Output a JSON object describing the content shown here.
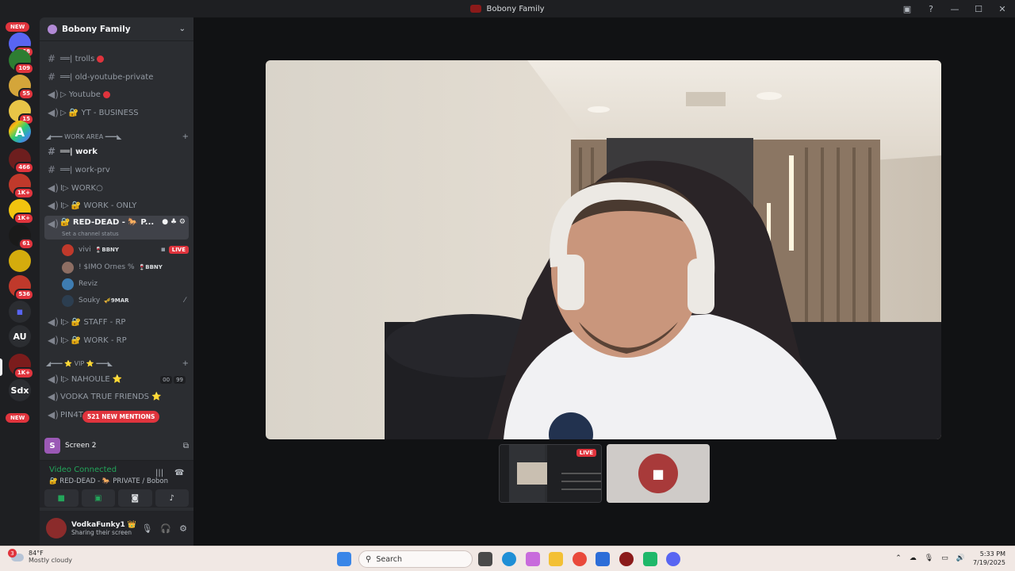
{
  "window": {
    "title": "Bobony Family"
  },
  "rail": {
    "new_top": "NEW",
    "new_bottom": "NEW",
    "badges": [
      "868",
      "109",
      "55",
      "15",
      "466",
      "1K+",
      "1K+",
      "61",
      "536",
      "1K+"
    ],
    "text_servers": [
      "AU",
      "Sdx"
    ],
    "letter_server": "A"
  },
  "guild": {
    "name": "Bobony Family"
  },
  "channels": {
    "trolls": "══| trolls",
    "old_youtube": "══| old-youtube-private",
    "youtube": "▷ Youtube",
    "yt_business": "▷ 🔐 YT - BUSINESS",
    "cat_work": "◢━━━ WORK AREA ━━━◣",
    "work": "══| work",
    "work_prv": "══| work-prv",
    "work_o": "I▷ WORK○",
    "work_only": "I▷ 🔐 WORK - ONLY",
    "red_dead": "🔐 RED-DEAD - 🐎 P...",
    "red_dead_status": "Set a channel status",
    "staff_rp": "I▷ 🔐 STAFF - RP",
    "work_rp": "I▷ 🔐 WORK - RP",
    "cat_vip": "◢━━━ ⭐ VIP ⭐ ━━━◣",
    "nahoule": "I▷ NAHOULE ⭐",
    "nahoule_c1": "00",
    "nahoule_c2": "99",
    "vodka": "VODKA TRUE FRIENDS ⭐",
    "pin": "PIN4T",
    "mentions": "521 NEW MENTIONS"
  },
  "voice_users": [
    {
      "name": "vivi",
      "tag": "🍷BBNY",
      "live": "LIVE"
    },
    {
      "name": "! $IMO Ornes %",
      "tag": "🍷BBNY"
    },
    {
      "name": "Reviz",
      "tag": ""
    },
    {
      "name": "Souky",
      "tag": "🎺9MAR"
    }
  ],
  "screen_share": {
    "label": "Screen 2",
    "letter": "S"
  },
  "voice_connection": {
    "status": "Video Connected",
    "channel": "🔐 RED-DEAD - 🐎 PRIVATE / Bobony F..."
  },
  "user": {
    "name": "VodkaFunky1 👑",
    "status": "Sharing their screen"
  },
  "thumbs": {
    "live": "LIVE"
  },
  "taskbar": {
    "temperature": "84°F",
    "weather": "Mostly cloudy",
    "weather_badge": "3",
    "search_placeholder": "Search",
    "time": "5:33 PM",
    "date": "7/19/2025"
  },
  "colors": {
    "accent_red": "#e0343d",
    "connected_green": "#23a55a",
    "sidebar": "#2b2d31"
  }
}
